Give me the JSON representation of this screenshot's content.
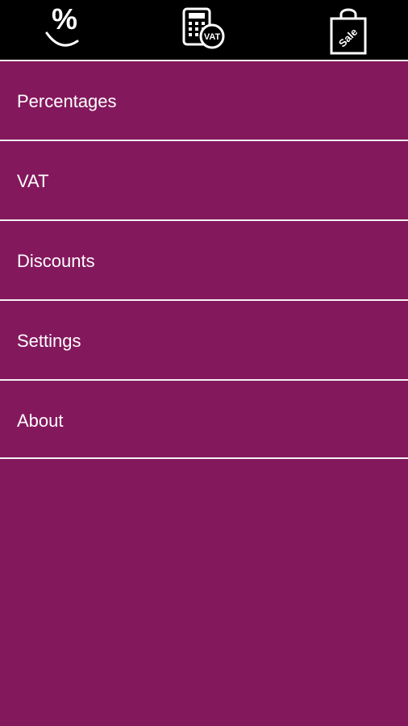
{
  "toolbar": {
    "tools": [
      {
        "icon": "percent-smile-icon",
        "label": "%"
      },
      {
        "icon": "vat-calculator-icon",
        "label": "VAT"
      },
      {
        "icon": "sale-bag-icon",
        "label": "Sale"
      }
    ]
  },
  "menu": {
    "items": [
      {
        "label": "Percentages"
      },
      {
        "label": "VAT"
      },
      {
        "label": "Discounts"
      },
      {
        "label": "Settings"
      },
      {
        "label": "About"
      }
    ]
  },
  "colors": {
    "toolbar_background": "#000000",
    "page_background": "#84185d",
    "divider": "#f2f2f2",
    "text": "#ffffff"
  }
}
